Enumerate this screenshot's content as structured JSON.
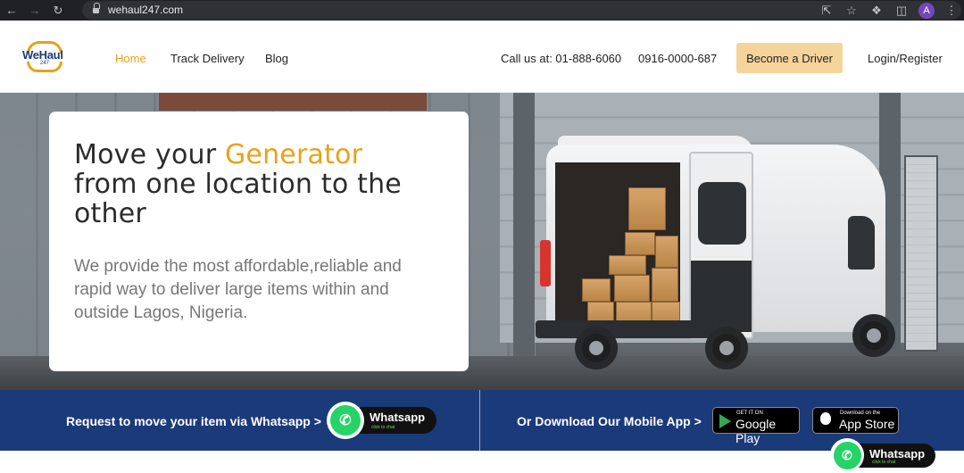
{
  "browser": {
    "url": "wehaul247.com",
    "profile_initial": "A"
  },
  "header": {
    "logo_text": "WeHaul",
    "logo_sub": "247",
    "nav": [
      {
        "label": "Home",
        "active": true
      },
      {
        "label": "Track Delivery",
        "active": false
      },
      {
        "label": "Blog",
        "active": false
      }
    ],
    "phone_1": "Call us at: 01-888-6060",
    "phone_2": "0916-0000-687",
    "driver_button": "Become a Driver",
    "login": "Login/Register"
  },
  "hero": {
    "headline_prefix": "Move your ",
    "headline_accent": "Generator",
    "headline_rest": "from one location to the other",
    "subtext": "We provide the most affordable,reliable and rapid way to deliver large items within and outside Lagos, Nigeria."
  },
  "banner": {
    "whatsapp_prompt": "Request to move your item via Whatsapp >",
    "whatsapp_label": "Whatsapp",
    "whatsapp_sub": "click to chat",
    "download_prompt": "Or Download Our Mobile App >",
    "google_small": "GET IT ON",
    "google_big": "Google Play",
    "apple_small": "Download on the",
    "apple_big": "App Store"
  },
  "floating": {
    "whatsapp_label": "Whatsapp",
    "whatsapp_sub": "click to chat"
  },
  "colors": {
    "accent": "#e8a21b",
    "brand_blue": "#1b3a7a",
    "driver_button": "#f5d49b",
    "whatsapp_green": "#25d366"
  }
}
